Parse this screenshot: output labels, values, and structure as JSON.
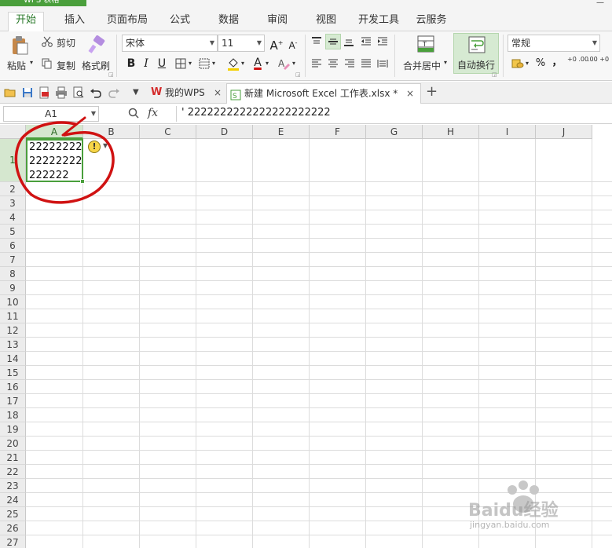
{
  "app": {
    "badge_label": "WPS 表格",
    "window_mark": "—"
  },
  "menu_tabs": [
    {
      "label": "开始",
      "active": true
    },
    {
      "label": "插入"
    },
    {
      "label": "页面布局"
    },
    {
      "label": "公式"
    },
    {
      "label": "数据"
    },
    {
      "label": "审阅"
    },
    {
      "label": "视图"
    },
    {
      "label": "开发工具"
    },
    {
      "label": "云服务"
    }
  ],
  "ribbon": {
    "paste_label": "粘贴",
    "cut_label": "剪切",
    "copy_label": "复制",
    "format_painter_label": "格式刷",
    "font_name": "宋体",
    "font_size": "11",
    "grow_font": "A",
    "shrink_font": "A",
    "bold": "B",
    "italic": "I",
    "underline": "U",
    "font_color_glyph": "A",
    "merge_center_label": "合并居中",
    "wrap_text_label": "自动换行",
    "number_format": "常规",
    "percent": "%",
    "thousands": "，",
    "inc_decimal": "+0 .00",
    "dec_decimal": ".00 +0"
  },
  "quick_access": {
    "tabs": [
      {
        "label": "我的WPS",
        "close": "×",
        "icon": "wps-logo-icon"
      },
      {
        "label": "新建 Microsoft Excel 工作表.xlsx *",
        "close": "×",
        "icon": "excel-file-icon",
        "active": true
      }
    ],
    "new_tab": "+"
  },
  "formula_bar": {
    "name_box": "A1",
    "fx_label": "fx",
    "content": "' 2222222222222222222222"
  },
  "sheet": {
    "columns": [
      "A",
      "B",
      "C",
      "D",
      "E",
      "F",
      "G",
      "H",
      "I",
      "J"
    ],
    "rows": [
      "1",
      "2",
      "3",
      "4",
      "5",
      "6",
      "7",
      "8",
      "9",
      "10",
      "11",
      "12",
      "13",
      "14",
      "15",
      "16",
      "17",
      "18",
      "19",
      "20",
      "21",
      "22",
      "23",
      "24",
      "25",
      "26",
      "27"
    ],
    "selected_cell": "A1",
    "a1_lines": [
      "22222222",
      "22222222",
      "222222"
    ],
    "warning_icon": "!"
  },
  "watermark": {
    "text": "Baidu经验",
    "subtext": "jingyan.baidu.com"
  },
  "colors": {
    "accent": "#4a9f3c",
    "annotation": "#d01212",
    "selection_fill": "#d5e7cf"
  }
}
